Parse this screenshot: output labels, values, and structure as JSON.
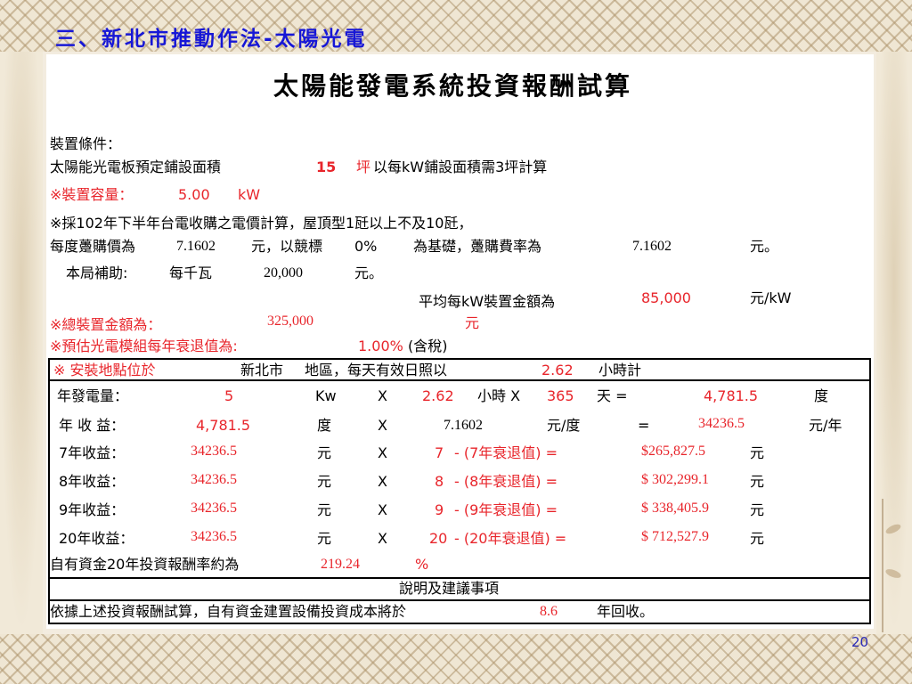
{
  "slide": {
    "title": "三、新北市推動作法-太陽光電",
    "page_number": "20"
  },
  "doc": {
    "title": "太陽能發電系統投資報酬試算",
    "conditions_label": "裝置條件：",
    "area": {
      "label": "太陽能光電板預定鋪設面積",
      "value": "15",
      "unit_note_red": "坪",
      "unit_note": "以每kW鋪設面積需3坪計算"
    },
    "capacity": {
      "label": "※裝置容量：",
      "value": "5.00",
      "unit": "kW"
    },
    "price": {
      "line1": "※採102年下半年台電收購之電價計算，屋頂型1瓩以上不及10瓩，",
      "label": "每度躉購價為",
      "value": "7.1602",
      "text1": "元，以競標",
      "percent": "0%",
      "text2": "為基礎，躉購費率為",
      "rate": "7.1602",
      "unit": "元。"
    },
    "subsidy": {
      "label": "本局補助:",
      "per": "每千瓦",
      "value": "20,000",
      "unit": "元。"
    },
    "avg": {
      "label": "平均每kW裝置金額為",
      "value": "85,000",
      "unit": "元/kW"
    },
    "total": {
      "label": "※總裝置金額為：",
      "value": "325,000",
      "unit": "元"
    },
    "decay": {
      "label": "※預估光電模組每年衰退值為:",
      "value": "1.00%",
      "note": "(含稅)"
    },
    "location": {
      "label": "※  安裝地點位於",
      "city": "新北市",
      "text": "地區，每天有效日照以",
      "hours": "2.62",
      "unit": "小時計"
    },
    "annual_gen": {
      "label": "年發電量：",
      "kw": "5",
      "kw_unit": "Kw",
      "x1": "X",
      "hours": "2.62",
      "hours_unit": "小時 X",
      "days": "365",
      "days_unit": "天 =",
      "result": "4,781.5",
      "result_unit": "度"
    },
    "annual_income": {
      "label": "年 收 益：",
      "kwh": "4,781.5",
      "kwh_unit": "度",
      "x": "X",
      "rate": "7.1602",
      "rate_unit": "元/度",
      "eq": "=",
      "result": "34236.5",
      "result_unit": "元/年"
    },
    "income_rows": [
      {
        "label": "7年收益：",
        "value": "34236.5",
        "unit": "元",
        "x": "X",
        "years": "7",
        "decay_text": "-  (7年衰退值) =",
        "result": "$265,827.5",
        "result_unit": "元"
      },
      {
        "label": "8年收益：",
        "value": "34236.5",
        "unit": "元",
        "x": "X",
        "years": "8",
        "decay_text": "-  (8年衰退值) =",
        "result": "$ 302,299.1",
        "result_unit": "元"
      },
      {
        "label": "9年收益：",
        "value": "34236.5",
        "unit": "元",
        "x": "X",
        "years": "9",
        "decay_text": "-  (9年衰退值) =",
        "result": "$ 338,405.9",
        "result_unit": "元"
      },
      {
        "label": "20年收益：",
        "value": "34236.5",
        "unit": "元",
        "x": "X",
        "years": "20",
        "decay_text": "- (20年衰退值) =",
        "result": "$ 712,527.9",
        "result_unit": "元"
      }
    ],
    "roi": {
      "label": "自有資金20年投資報酬率約為",
      "value": "219.24",
      "unit": "%"
    },
    "notes_header": "說明及建議事項",
    "payback": {
      "label": "依據上述投資報酬試算，自有資金建置設備投資成本將於",
      "value": "8.6",
      "unit": "年回收。"
    }
  }
}
